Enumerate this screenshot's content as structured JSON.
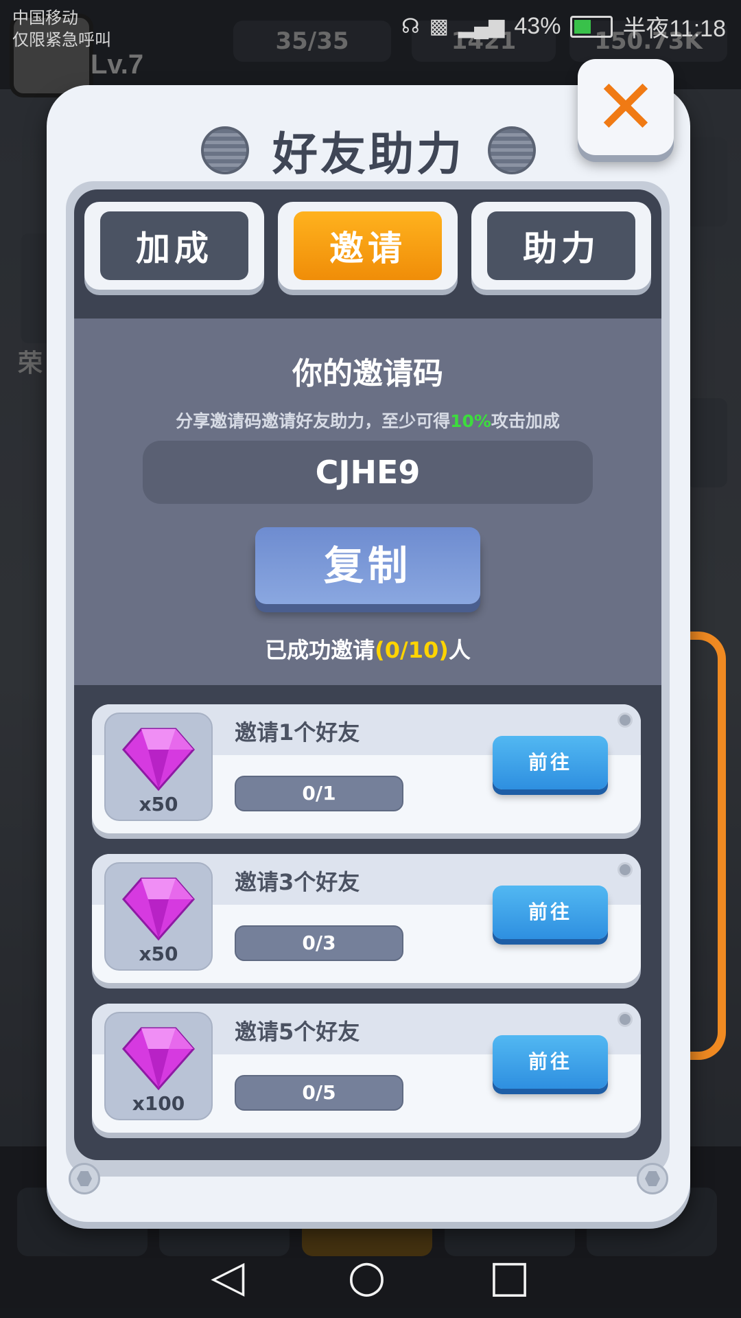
{
  "status_bar": {
    "carrier_line1": "中国移动",
    "carrier_line2": "仅限紧急呼叫",
    "battery_percent": "43%",
    "time": "半夜11:18"
  },
  "background": {
    "level": "Lv.7",
    "energy": "35/35",
    "gems": "1421",
    "cash": "150.73K",
    "side_label": "荣"
  },
  "modal": {
    "title": "好友助力",
    "tabs": [
      {
        "label": "加成",
        "active": false
      },
      {
        "label": "邀请",
        "active": true
      },
      {
        "label": "助力",
        "active": false
      }
    ],
    "invite": {
      "heading": "你的邀请码",
      "desc_before": "分享邀请码邀请好友助力，至少可得",
      "desc_highlight": "10%",
      "desc_after": "攻击加成",
      "code": "CJHE9",
      "copy_label": "复制",
      "count_before": "已成功邀请",
      "count_value": "(0/10)",
      "count_after": "人"
    },
    "tasks": [
      {
        "title": "邀请1个好友",
        "reward_qty": "x50",
        "progress": "0/1",
        "progress_fraction": 0,
        "button": "前往"
      },
      {
        "title": "邀请3个好友",
        "reward_qty": "x50",
        "progress": "0/3",
        "progress_fraction": 0,
        "button": "前往"
      },
      {
        "title": "邀请5个好友",
        "reward_qty": "x100",
        "progress": "0/5",
        "progress_fraction": 0,
        "button": "前往"
      }
    ]
  },
  "icons": {
    "close": "close-icon",
    "gem": "gem-icon",
    "nav_back": "back-icon",
    "nav_home": "home-icon",
    "nav_recent": "recent-apps-icon"
  },
  "colors": {
    "accent_orange": "#f08d08",
    "go_button_blue": "#2e8fe0",
    "highlight_green": "#3ddc3d",
    "count_yellow": "#ffd400"
  }
}
